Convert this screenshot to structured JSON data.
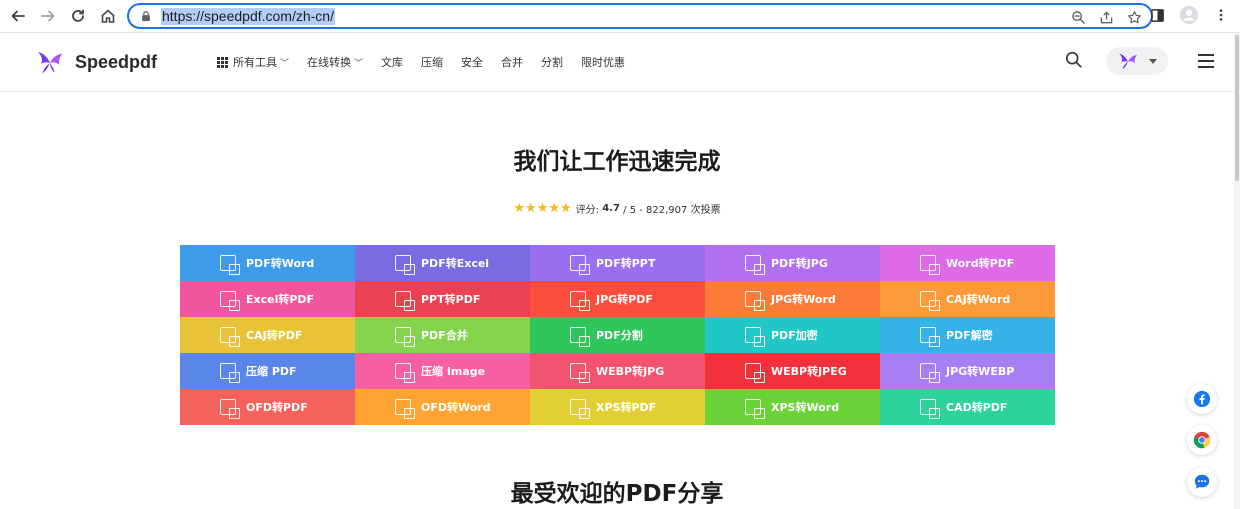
{
  "browser": {
    "url": "https://speedpdf.com/zh-cn/",
    "icons": [
      "back-icon",
      "forward-icon",
      "reload-icon",
      "home-icon",
      "lock-icon",
      "zoom-icon",
      "share-icon",
      "star-icon",
      "sidebar-icon",
      "profile-icon",
      "more-icon"
    ]
  },
  "header": {
    "logo_text": "Speedpdf",
    "menu": [
      {
        "label": "所有工具",
        "chevron": true,
        "grid": true
      },
      {
        "label": "在线转换",
        "chevron": true
      },
      {
        "label": "文库"
      },
      {
        "label": "压缩"
      },
      {
        "label": "安全"
      },
      {
        "label": "合并"
      },
      {
        "label": "分割"
      },
      {
        "label": "限时优惠"
      }
    ]
  },
  "hero": {
    "title": "我们让工作迅速完成",
    "rating_label": "评分:",
    "rating_value": "4.7",
    "rating_rest": "/ 5 - 822,907 次投票",
    "stars": "★★★★★"
  },
  "tools": [
    {
      "label": "PDF转Word",
      "color": "#3d9be9"
    },
    {
      "label": "PDF转Excel",
      "color": "#7b6be3"
    },
    {
      "label": "PDF转PPT",
      "color": "#9a6ef0"
    },
    {
      "label": "PDF转JPG",
      "color": "#b26ff0"
    },
    {
      "label": "Word转PDF",
      "color": "#dd6be6"
    },
    {
      "label": "Excel转PDF",
      "color": "#f1569d"
    },
    {
      "label": "PPT转PDF",
      "color": "#ea4253"
    },
    {
      "label": "JPG转PDF",
      "color": "#fb4d3d"
    },
    {
      "label": "JPG转Word",
      "color": "#fc7b39"
    },
    {
      "label": "CAJ转Word",
      "color": "#fc9938"
    },
    {
      "label": "CAJ转PDF",
      "color": "#e8c33a"
    },
    {
      "label": "PDF合并",
      "color": "#86d44e"
    },
    {
      "label": "PDF分割",
      "color": "#2ec65b"
    },
    {
      "label": "PDF加密",
      "color": "#20c7c7"
    },
    {
      "label": "PDF解密",
      "color": "#35b3e6"
    },
    {
      "label": "压缩 PDF",
      "color": "#5a86ea"
    },
    {
      "label": "压缩 Image",
      "color": "#f65fa2"
    },
    {
      "label": "WEBP转JPG",
      "color": "#f25470"
    },
    {
      "label": "WEBP转JPEG",
      "color": "#f0303b"
    },
    {
      "label": "JPG转WEBP",
      "color": "#a77ff3"
    },
    {
      "label": "OFD转PDF",
      "color": "#f4625b"
    },
    {
      "label": "OFD转Word",
      "color": "#ffa432"
    },
    {
      "label": "XPS转PDF",
      "color": "#e2cf36"
    },
    {
      "label": "XPS转Word",
      "color": "#6ad337"
    },
    {
      "label": "CAD转PDF",
      "color": "#2dd39b"
    }
  ],
  "section2": {
    "title": "最受欢迎的PDF分享"
  },
  "floating": [
    {
      "icon": "facebook-icon"
    },
    {
      "icon": "chrome-icon"
    },
    {
      "icon": "chat-icon"
    }
  ]
}
